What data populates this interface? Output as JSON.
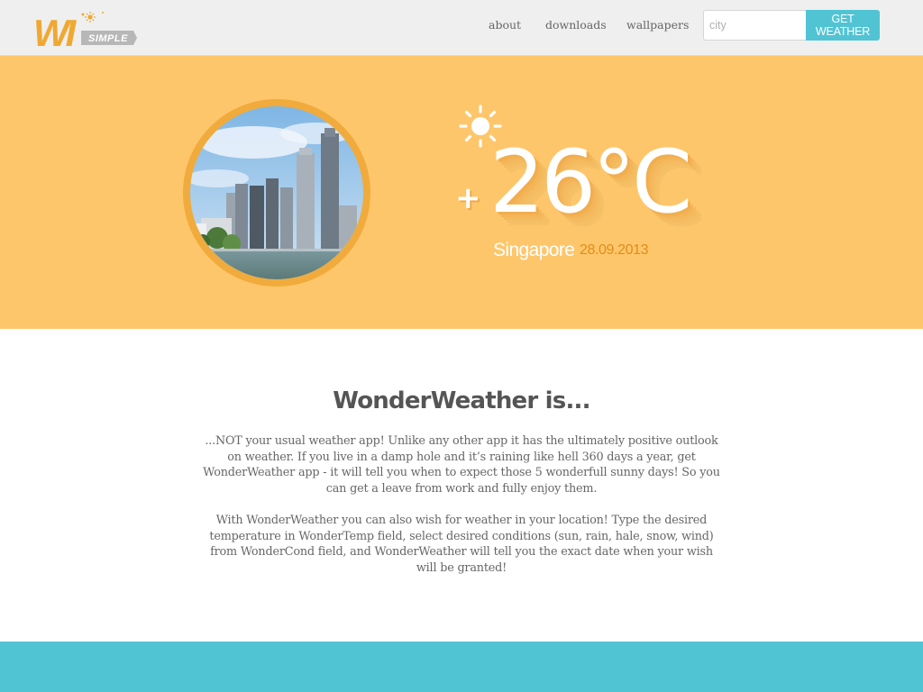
{
  "logo": {
    "mark": "WI",
    "tag": "SIMPLE"
  },
  "nav": {
    "about": "about",
    "downloads": "downloads",
    "wallpapers": "wallpapers"
  },
  "search": {
    "placeholder": "city",
    "button_label": "GET WEATHER"
  },
  "weather": {
    "icon": "sun-icon",
    "sign": "+",
    "temperature": "26°C",
    "city": "Singapore",
    "date": "28.09.2013"
  },
  "about": {
    "title": "WonderWeather is...",
    "paragraphs": [
      "...NOT your usual weather app! Unlike any other app it has the ultimately positive outlook on weather. If you live in a damp hole and it’s raining like hell 360 days a year, get WonderWeather app - it will tell you when to expect those 5 wonderfull sunny days! So you can get a leave from work and fully enjoy them.",
      "With WonderWeather you can also wish for weather in your location! Type the desired temperature in WonderTemp field, select desired conditions (sun, rain, hale, snow, wind) from WonderCond field, and WonderWeather will tell you the exact date when your wish will be granted!"
    ]
  },
  "colors": {
    "hero": "#fec66b",
    "accent": "#51c4d4",
    "logo_orange": "#f0a830",
    "date": "#e08d18"
  }
}
